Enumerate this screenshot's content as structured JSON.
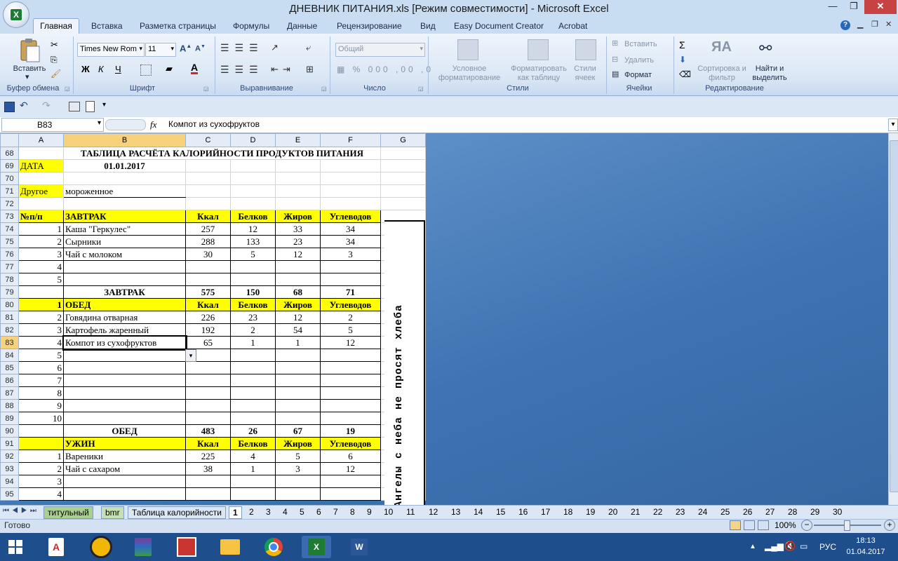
{
  "window": {
    "title": "ДНЕВНИК ПИТАНИЯ.xls  [Режим совместимости] - Microsoft Excel",
    "minimize": "—",
    "restore": "❐",
    "close": "✕"
  },
  "ribbon_tabs": [
    "Главная",
    "Вставка",
    "Разметка страницы",
    "Формулы",
    "Данные",
    "Рецензирование",
    "Вид",
    "Easy Document Creator",
    "Acrobat"
  ],
  "ribbon": {
    "paste": "Вставить",
    "font_name": "Times New Rom",
    "font_size": "11",
    "number_format": "Общий",
    "cond_format": "Условное форматирование",
    "format_table": "Форматировать как таблицу",
    "cell_styles": "Стили ячеек",
    "insert": "Вставить",
    "delete": "Удалить",
    "format": "Формат",
    "sort": "Сортировка и фильтр",
    "find": "Найти и выделить",
    "groups": {
      "clipboard": "Буфер обмена",
      "font": "Шрифт",
      "alignment": "Выравнивание",
      "number": "Число",
      "styles": "Стили",
      "cells": "Ячейки",
      "editing": "Редактирование"
    }
  },
  "formula_bar": {
    "name_box": "B83",
    "fx": "fx",
    "content": "Компот из сухофруктов"
  },
  "columns": [
    "A",
    "B",
    "C",
    "D",
    "E",
    "F",
    "G"
  ],
  "rows": [
    {
      "n": "68",
      "a": "",
      "b": "ТАБЛИЦА РАСЧЁТА КАЛОРИЙНОСТИ ПРОДУКТОВ ПИТАНИЯ",
      "c": "",
      "d": "",
      "e": "",
      "f": ""
    },
    {
      "n": "69",
      "a": "ДАТА",
      "b": "01.01.2017",
      "c": "",
      "d": "",
      "e": "",
      "f": ""
    },
    {
      "n": "70",
      "a": "",
      "b": "",
      "c": "",
      "d": "",
      "e": "",
      "f": ""
    },
    {
      "n": "71",
      "a": "Другое",
      "b": "мороженное",
      "c": "",
      "d": "",
      "e": "",
      "f": ""
    },
    {
      "n": "72",
      "a": "",
      "b": "",
      "c": "",
      "d": "",
      "e": "",
      "f": ""
    },
    {
      "n": "73",
      "a": "№п/п",
      "b": "ЗАВТРАК",
      "c": "Ккал",
      "d": "Белков",
      "e": "Жиров",
      "f": "Углеводов"
    },
    {
      "n": "74",
      "a": "1",
      "b": "Каша \"Геркулес\"",
      "c": "257",
      "d": "12",
      "e": "33",
      "f": "34"
    },
    {
      "n": "75",
      "a": "2",
      "b": "Сырники",
      "c": "288",
      "d": "133",
      "e": "23",
      "f": "34"
    },
    {
      "n": "76",
      "a": "3",
      "b": "Чай с молоком",
      "c": "30",
      "d": "5",
      "e": "12",
      "f": "3"
    },
    {
      "n": "77",
      "a": "4",
      "b": "",
      "c": "",
      "d": "",
      "e": "",
      "f": ""
    },
    {
      "n": "78",
      "a": "5",
      "b": "",
      "c": "",
      "d": "",
      "e": "",
      "f": ""
    },
    {
      "n": "79",
      "a": "",
      "b": "ЗАВТРАК",
      "c": "575",
      "d": "150",
      "e": "68",
      "f": "71"
    },
    {
      "n": "80",
      "a": "1",
      "b": "ОБЕД",
      "c": "Ккал",
      "d": "Белков",
      "e": "Жиров",
      "f": "Углеводов"
    },
    {
      "n": "81",
      "a": "2",
      "b": "Говядина отварная",
      "c": "226",
      "d": "23",
      "e": "12",
      "f": "2"
    },
    {
      "n": "82",
      "a": "3",
      "b": "Картофель жаренный",
      "c": "192",
      "d": "2",
      "e": "54",
      "f": "5"
    },
    {
      "n": "83",
      "a": "4",
      "b": "Компот из сухофруктов",
      "c": "65",
      "d": "1",
      "e": "1",
      "f": "12"
    },
    {
      "n": "84",
      "a": "5",
      "b": "",
      "c": "",
      "d": "",
      "e": "",
      "f": ""
    },
    {
      "n": "85",
      "a": "6",
      "b": "",
      "c": "",
      "d": "",
      "e": "",
      "f": ""
    },
    {
      "n": "86",
      "a": "7",
      "b": "",
      "c": "",
      "d": "",
      "e": "",
      "f": ""
    },
    {
      "n": "87",
      "a": "8",
      "b": "",
      "c": "",
      "d": "",
      "e": "",
      "f": ""
    },
    {
      "n": "88",
      "a": "9",
      "b": "",
      "c": "",
      "d": "",
      "e": "",
      "f": ""
    },
    {
      "n": "89",
      "a": "10",
      "b": "",
      "c": "",
      "d": "",
      "e": "",
      "f": ""
    },
    {
      "n": "90",
      "a": "",
      "b": "ОБЕД",
      "c": "483",
      "d": "26",
      "e": "67",
      "f": "19"
    },
    {
      "n": "91",
      "a": "",
      "b": "УЖИН",
      "c": "Ккал",
      "d": "Белков",
      "e": "Жиров",
      "f": "Углеводов"
    },
    {
      "n": "92",
      "a": "1",
      "b": "Вареники",
      "c": "225",
      "d": "4",
      "e": "5",
      "f": "6"
    },
    {
      "n": "93",
      "a": "2",
      "b": "Чай с сахаром",
      "c": "38",
      "d": "1",
      "e": "3",
      "f": "12"
    },
    {
      "n": "94",
      "a": "3",
      "b": "",
      "c": "",
      "d": "",
      "e": "",
      "f": ""
    },
    {
      "n": "95",
      "a": "4",
      "b": "",
      "c": "",
      "d": "",
      "e": "",
      "f": ""
    }
  ],
  "vertical_text": "Ангелы с неба не просят хлеба",
  "sheet_tabs": [
    "титульный",
    "bmr",
    "Таблица калорийности",
    "1",
    "2",
    "3",
    "4",
    "5",
    "6",
    "7",
    "8",
    "9",
    "10",
    "11",
    "12",
    "13",
    "14",
    "15",
    "16",
    "17",
    "18",
    "19",
    "20",
    "21",
    "22",
    "23",
    "24",
    "25",
    "26",
    "27",
    "28",
    "29",
    "30"
  ],
  "status": {
    "ready": "Готово",
    "zoom": "100%"
  },
  "taskbar": {
    "lang": "РУС",
    "time": "18:13",
    "date": "01.04.2017"
  }
}
